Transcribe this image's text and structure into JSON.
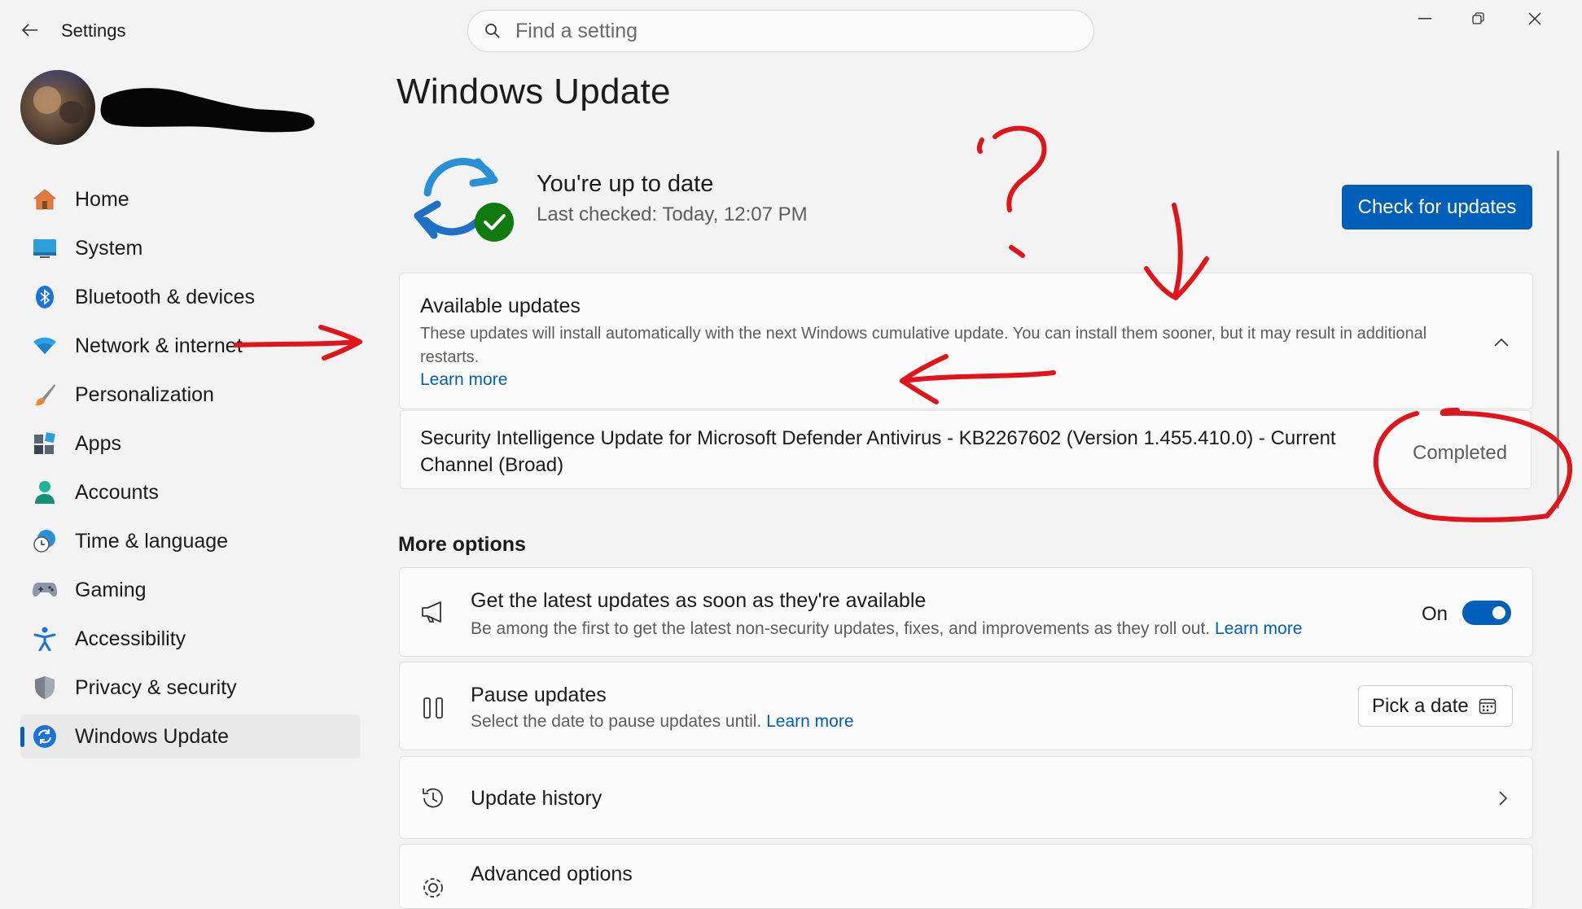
{
  "app": {
    "title": "Settings",
    "search_placeholder": "Find a setting"
  },
  "sidebar": {
    "items": [
      {
        "label": "Home",
        "icon": "home-icon"
      },
      {
        "label": "System",
        "icon": "system-icon"
      },
      {
        "label": "Bluetooth & devices",
        "icon": "bluetooth-icon"
      },
      {
        "label": "Network & internet",
        "icon": "network-icon"
      },
      {
        "label": "Personalization",
        "icon": "brush-icon"
      },
      {
        "label": "Apps",
        "icon": "apps-icon"
      },
      {
        "label": "Accounts",
        "icon": "accounts-icon"
      },
      {
        "label": "Time & language",
        "icon": "time-language-icon"
      },
      {
        "label": "Gaming",
        "icon": "gaming-icon"
      },
      {
        "label": "Accessibility",
        "icon": "accessibility-icon"
      },
      {
        "label": "Privacy & security",
        "icon": "shield-icon"
      },
      {
        "label": "Windows Update",
        "icon": "windows-update-icon",
        "selected": true
      }
    ]
  },
  "main": {
    "title": "Windows Update",
    "status": {
      "title": "You're up to date",
      "subtitle": "Last checked: Today, 12:07 PM"
    },
    "check_button": "Check for updates",
    "available": {
      "title": "Available updates",
      "description": "These updates will install automatically with the next Windows cumulative update. You can install them sooner, but it may result in additional restarts.",
      "learn_more": "Learn more",
      "updates": [
        {
          "name": "Security Intelligence Update for Microsoft Defender Antivirus - KB2267602 (Version 1.455.410.0) - Current Channel (Broad)",
          "status": "Completed"
        }
      ]
    },
    "more_options": {
      "heading": "More options",
      "latest": {
        "title": "Get the latest updates as soon as they're available",
        "description": "Be among the first to get the latest non-security updates, fixes, and improvements as they roll out.",
        "learn_more": "Learn more",
        "toggle_label": "On",
        "toggle_on": true
      },
      "pause": {
        "title": "Pause updates",
        "description": "Select the date to pause updates until.",
        "learn_more": "Learn more",
        "button": "Pick a date"
      },
      "history": {
        "title": "Update history"
      },
      "advanced": {
        "title": "Advanced options"
      }
    }
  },
  "colors": {
    "accent": "#005fb8",
    "annotation": "#e0151b",
    "background": "#f3f3f3",
    "card": "#fbfbfb"
  }
}
